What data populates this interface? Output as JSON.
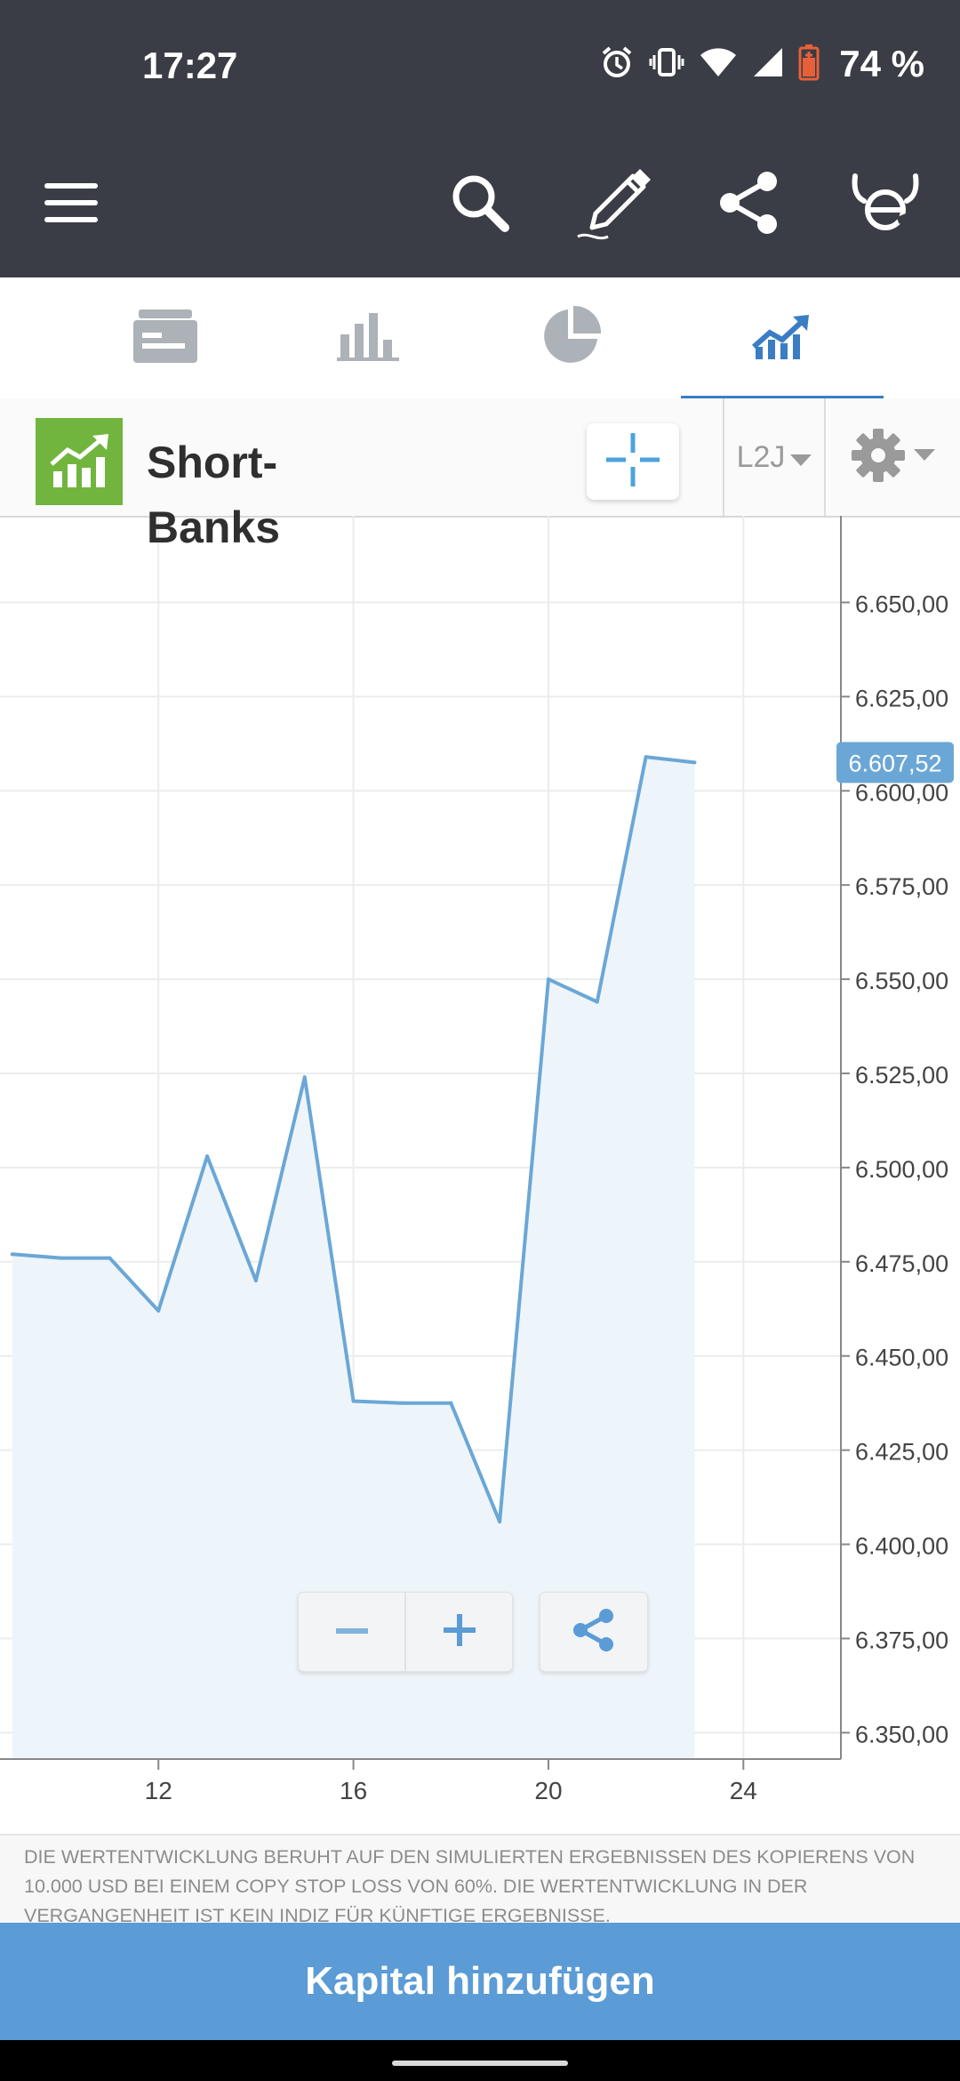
{
  "status_bar": {
    "time": "17:27",
    "battery": "74 %",
    "icons": [
      "alarm-icon",
      "vibrate-icon",
      "wifi-icon",
      "signal-icon",
      "battery-icon"
    ]
  },
  "app_bar": {
    "icons": [
      "menu-icon",
      "search-icon",
      "edit-icon",
      "share-icon",
      "etoro-icon"
    ]
  },
  "tabs": [
    {
      "name": "feed-tab",
      "icon": "news-icon",
      "active": false
    },
    {
      "name": "stats-tab",
      "icon": "bar-chart-icon",
      "active": false
    },
    {
      "name": "portfolio-tab",
      "icon": "pie-chart-icon",
      "active": false
    },
    {
      "name": "chart-tab",
      "icon": "trend-chart-icon",
      "active": true
    }
  ],
  "instrument": {
    "name_line1": "Short-",
    "name_line2": "Banks",
    "range": "L2J"
  },
  "colors": {
    "accent": "#3a7dc4",
    "line": "#6ba7d6",
    "area": "#eef5fa",
    "price_tag": "#6ba7d6",
    "cta": "#5b9bd6",
    "logo_green": "#71b53e",
    "header": "#3a3d45"
  },
  "chart_data": {
    "type": "area",
    "x": [
      9,
      10,
      11,
      12,
      13,
      14,
      15,
      16,
      17,
      18,
      19,
      20,
      21,
      22,
      23
    ],
    "values": [
      6477,
      6476,
      6476,
      6462,
      6503,
      6470,
      6524,
      6438,
      6437.5,
      6437.5,
      6406,
      6550,
      6544,
      6609,
      6607.52
    ],
    "last_value_label": "6.607,52",
    "xlim": [
      8.75,
      26
    ],
    "ylim": [
      6343,
      6673
    ],
    "x_ticks": [
      {
        "value": 12,
        "label": "12"
      },
      {
        "value": 16,
        "label": "16"
      },
      {
        "value": 20,
        "label": "20"
      },
      {
        "value": 24,
        "label": "24"
      }
    ],
    "y_ticks": [
      {
        "value": 6650,
        "label": "6.650,00"
      },
      {
        "value": 6625,
        "label": "6.625,00"
      },
      {
        "value": 6600,
        "label": "6.600,00"
      },
      {
        "value": 6575,
        "label": "6.575,00"
      },
      {
        "value": 6550,
        "label": "6.550,00"
      },
      {
        "value": 6525,
        "label": "6.525,00"
      },
      {
        "value": 6500,
        "label": "6.500,00"
      },
      {
        "value": 6475,
        "label": "6.475,00"
      },
      {
        "value": 6450,
        "label": "6.450,00"
      },
      {
        "value": 6425,
        "label": "6.425,00"
      },
      {
        "value": 6400,
        "label": "6.400,00"
      },
      {
        "value": 6375,
        "label": "6.375,00"
      },
      {
        "value": 6350,
        "label": "6.350,00"
      }
    ],
    "grid": true,
    "legend": "none",
    "title": "",
    "xlabel": "",
    "ylabel": ""
  },
  "chart_controls": {
    "zoom_out": "−",
    "zoom_in": "+"
  },
  "disclaimer": "DIE WERTENTWICKLUNG BERUHT AUF DEN SIMULIERTEN ERGEBNISSEN DES KOPIERENS VON 10.000 USD BEI EINEM COPY STOP LOSS VON 60%. DIE WERTENTWICKLUNG IN DER VERGANGENHEIT IST KEIN INDIZ FÜR KÜNFTIGE ERGEBNISSE.",
  "cta": {
    "label": "Kapital hinzufügen"
  }
}
